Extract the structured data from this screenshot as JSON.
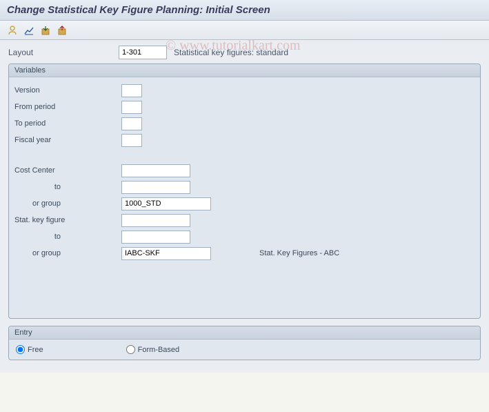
{
  "title": "Change Statistical Key Figure Planning: Initial Screen",
  "watermark": "© www.tutorialkart.com",
  "toolbar": {
    "icons": [
      "person-icon",
      "chart-icon",
      "package-icon",
      "save-icon"
    ]
  },
  "layout": {
    "label": "Layout",
    "value": "1-301",
    "desc": "Statistical key figures: standard"
  },
  "variables": {
    "title": "Variables",
    "version": {
      "label": "Version",
      "value": ""
    },
    "from_period": {
      "label": "From period",
      "value": ""
    },
    "to_period": {
      "label": "To period",
      "value": ""
    },
    "fiscal_year": {
      "label": "Fiscal year",
      "value": ""
    },
    "cost_center": {
      "label": "Cost Center",
      "value": ""
    },
    "cost_center_to": {
      "label": "to",
      "value": ""
    },
    "cost_center_group": {
      "label": "or group",
      "value": "1000_STD"
    },
    "stat_key_figure": {
      "label": "Stat. key figure",
      "value": ""
    },
    "stat_key_figure_to": {
      "label": "to",
      "value": ""
    },
    "stat_key_figure_group": {
      "label": "or group",
      "value": "IABC-SKF",
      "desc": "Stat. Key Figures - ABC"
    }
  },
  "entry": {
    "title": "Entry",
    "free": "Free",
    "form_based": "Form-Based",
    "selected": "free"
  }
}
